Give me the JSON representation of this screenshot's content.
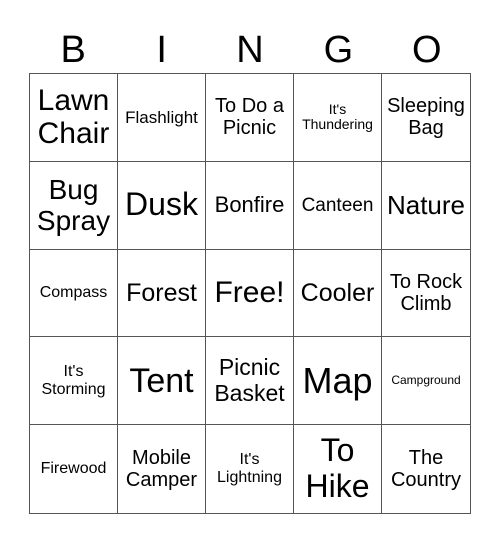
{
  "header": [
    "B",
    "I",
    "N",
    "G",
    "O"
  ],
  "cells": [
    {
      "text": "Lawn Chair",
      "size": 30
    },
    {
      "text": "Flashlight",
      "size": 17
    },
    {
      "text": "To Do a Picnic",
      "size": 20
    },
    {
      "text": "It's Thundering",
      "size": 14
    },
    {
      "text": "Sleeping Bag",
      "size": 20
    },
    {
      "text": "Bug Spray",
      "size": 28
    },
    {
      "text": "Dusk",
      "size": 32
    },
    {
      "text": "Bonfire",
      "size": 22
    },
    {
      "text": "Canteen",
      "size": 19
    },
    {
      "text": "Nature",
      "size": 26
    },
    {
      "text": "Compass",
      "size": 16
    },
    {
      "text": "Forest",
      "size": 25
    },
    {
      "text": "Free!",
      "size": 30
    },
    {
      "text": "Cooler",
      "size": 25
    },
    {
      "text": "To Rock Climb",
      "size": 20
    },
    {
      "text": "It's Storming",
      "size": 16
    },
    {
      "text": "Tent",
      "size": 34
    },
    {
      "text": "Picnic Basket",
      "size": 23
    },
    {
      "text": "Map",
      "size": 36
    },
    {
      "text": "Campground",
      "size": 12
    },
    {
      "text": "Firewood",
      "size": 16
    },
    {
      "text": "Mobile Camper",
      "size": 20
    },
    {
      "text": "It's Lightning",
      "size": 16
    },
    {
      "text": "To Hike",
      "size": 32
    },
    {
      "text": "The Country",
      "size": 20
    }
  ]
}
